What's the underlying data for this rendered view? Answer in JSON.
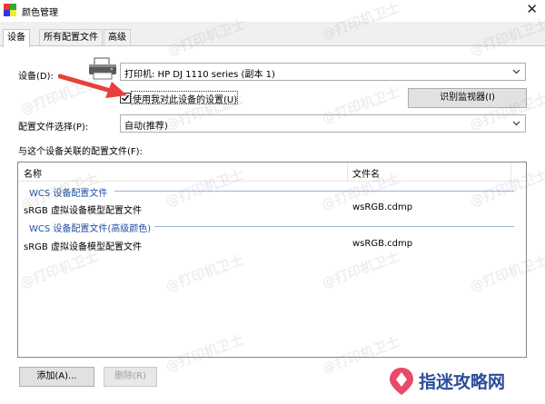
{
  "window": {
    "title": "颜色管理"
  },
  "tabs": [
    {
      "label": "设备",
      "active": true
    },
    {
      "label": "所有配置文件",
      "active": false
    },
    {
      "label": "高级",
      "active": false
    }
  ],
  "device": {
    "label": "设备(D):",
    "selected": "打印机: HP DJ 1110 series (副本 1)",
    "use_settings_label": "使用我对此设备的设置(U)",
    "use_settings_checked": true,
    "identify_button": "识别监视器(I)"
  },
  "profile_selection": {
    "label": "配置文件选择(P):",
    "selected": "自动(推荐)"
  },
  "associated_label": "与这个设备关联的配置文件(F):",
  "list": {
    "columns": [
      "名称",
      "文件名"
    ],
    "groups": [
      {
        "title": "WCS 设备配置文件",
        "rows": [
          {
            "name": "sRGB 虚拟设备模型配置文件",
            "file": "wsRGB.cdmp"
          }
        ]
      },
      {
        "title": "WCS 设备配置文件(高级颜色)",
        "rows": [
          {
            "name": "sRGB 虚拟设备模型配置文件",
            "file": "wsRGB.cdmp"
          }
        ]
      }
    ]
  },
  "buttons": {
    "add": "添加(A)...",
    "remove": "删除(R)"
  },
  "watermark_text": "@打印机卫士",
  "logo_text": "指迷攻略网",
  "colors": {
    "accent": "#1e4e9e",
    "arrow": "#e8403c"
  }
}
